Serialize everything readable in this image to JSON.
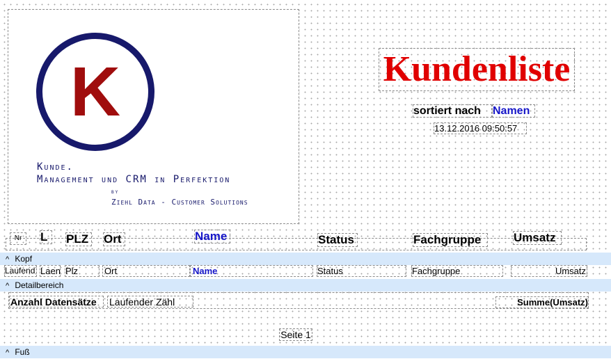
{
  "logo": {
    "letter": "K",
    "line1": "Kunde.",
    "line2": "Management und CRM in Perfektion",
    "line3": "by",
    "line4": "Ziehl Data - Customer Solutions"
  },
  "report": {
    "title": "Kundenliste",
    "sort_label": "sortiert nach",
    "sort_value": "Namen",
    "datetime": "13.12.2016 09:50:57"
  },
  "columns": {
    "nr": "Nr",
    "l": "L",
    "plz": "PLZ",
    "ort": "Ort",
    "name": "Name",
    "status": "Status",
    "fachgruppe": "Fachgruppe",
    "umsatz": "Umsatz"
  },
  "bands": {
    "kopf": "Kopf",
    "detail": "Detailbereich",
    "fuss": "Fuß"
  },
  "detail": {
    "laufend": "Laufend",
    "laender": "Laen",
    "plz": "Plz",
    "ort": "Ort",
    "name": "Name",
    "status": "Status",
    "fachgruppe": "Fachgruppe",
    "umsatz": "Umsatz"
  },
  "footer": {
    "count_label": "Anzahl Datensätze",
    "counter": "Laufender Zähl",
    "sum": "Summe(Umsatz)",
    "page": "Seite 1"
  },
  "colors": {
    "title_red": "#e00000",
    "name_blue": "#1515c8",
    "band_blue": "#d6e8fb",
    "logo_navy": "#17196b",
    "logo_red": "#a00d0d"
  }
}
